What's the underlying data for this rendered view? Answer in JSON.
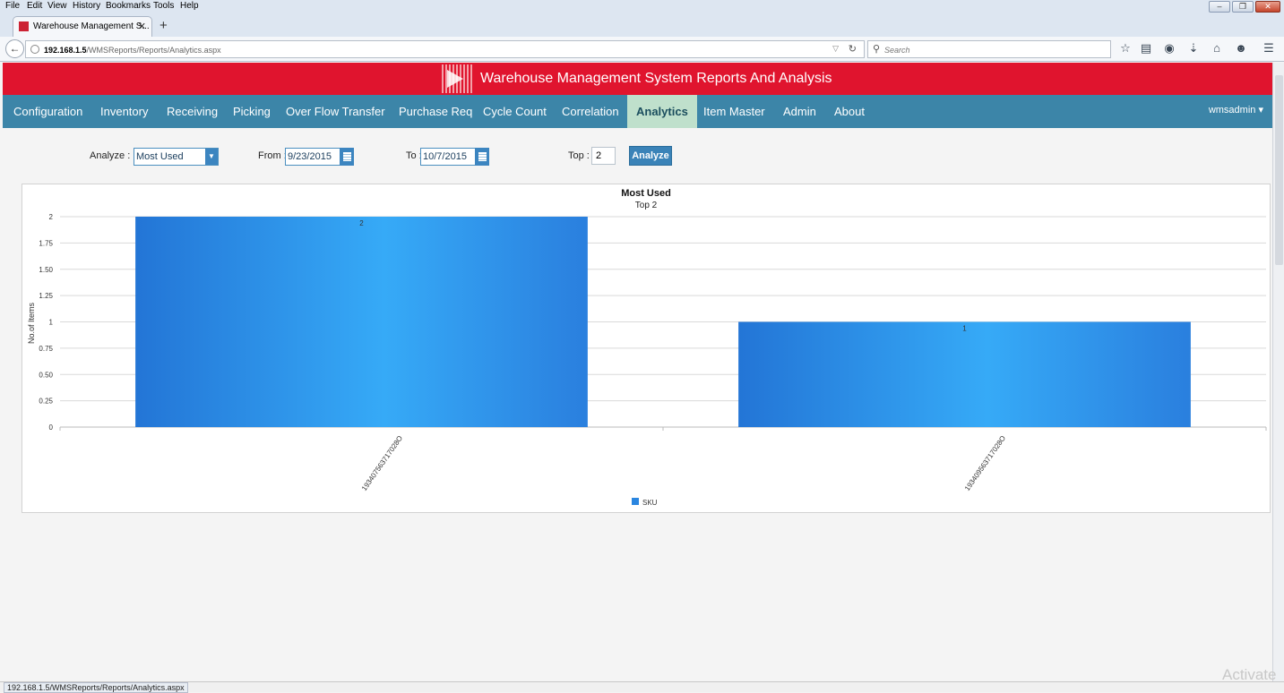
{
  "browser": {
    "menu": [
      "File",
      "Edit",
      "View",
      "History",
      "Bookmarks",
      "Tools",
      "Help"
    ],
    "tab_title": "Warehouse Management S...",
    "url_host": "192.168.1.5",
    "url_path": "/WMSReports/Reports/Analytics.aspx",
    "search_placeholder": "Search",
    "status_url": "192.168.1.5/WMSReports/Reports/Analytics.aspx"
  },
  "app": {
    "title": "Warehouse Management System Reports And Analysis",
    "nav": [
      "Configuration",
      "Inventory",
      "Receiving",
      "Picking",
      "Over Flow Transfer",
      "Purchase Req",
      "Cycle Count",
      "Correlation",
      "Analytics",
      "Item Master",
      "Admin",
      "About"
    ],
    "active_nav": "Analytics",
    "user": "wmsadmin"
  },
  "filters": {
    "analyze_label": "Analyze  :",
    "analyze_value": "Most Used",
    "from_label": "From :",
    "from_value": "9/23/2015",
    "to_label": "To :",
    "to_value": "10/7/2015",
    "top_label": "Top :",
    "top_value": "2",
    "analyze_button": "Analyze"
  },
  "chart_data": {
    "type": "bar",
    "title": "Most Used",
    "subtitle": "Top 2",
    "ylabel": "No.of Items",
    "xlabel": "",
    "categories": [
      "193407563717028O",
      "193409563717028O"
    ],
    "series": [
      {
        "name": "SKU",
        "values": [
          2,
          1
        ]
      }
    ],
    "ylim": [
      0,
      2
    ],
    "yticks": [
      "0",
      "0.25",
      "0.50",
      "0.75",
      "1",
      "1.25",
      "1.50",
      "1.75",
      "2"
    ],
    "grid": true,
    "legend": "bottom-center",
    "bar_color": "#2a86e0"
  },
  "watermark": "Activate"
}
